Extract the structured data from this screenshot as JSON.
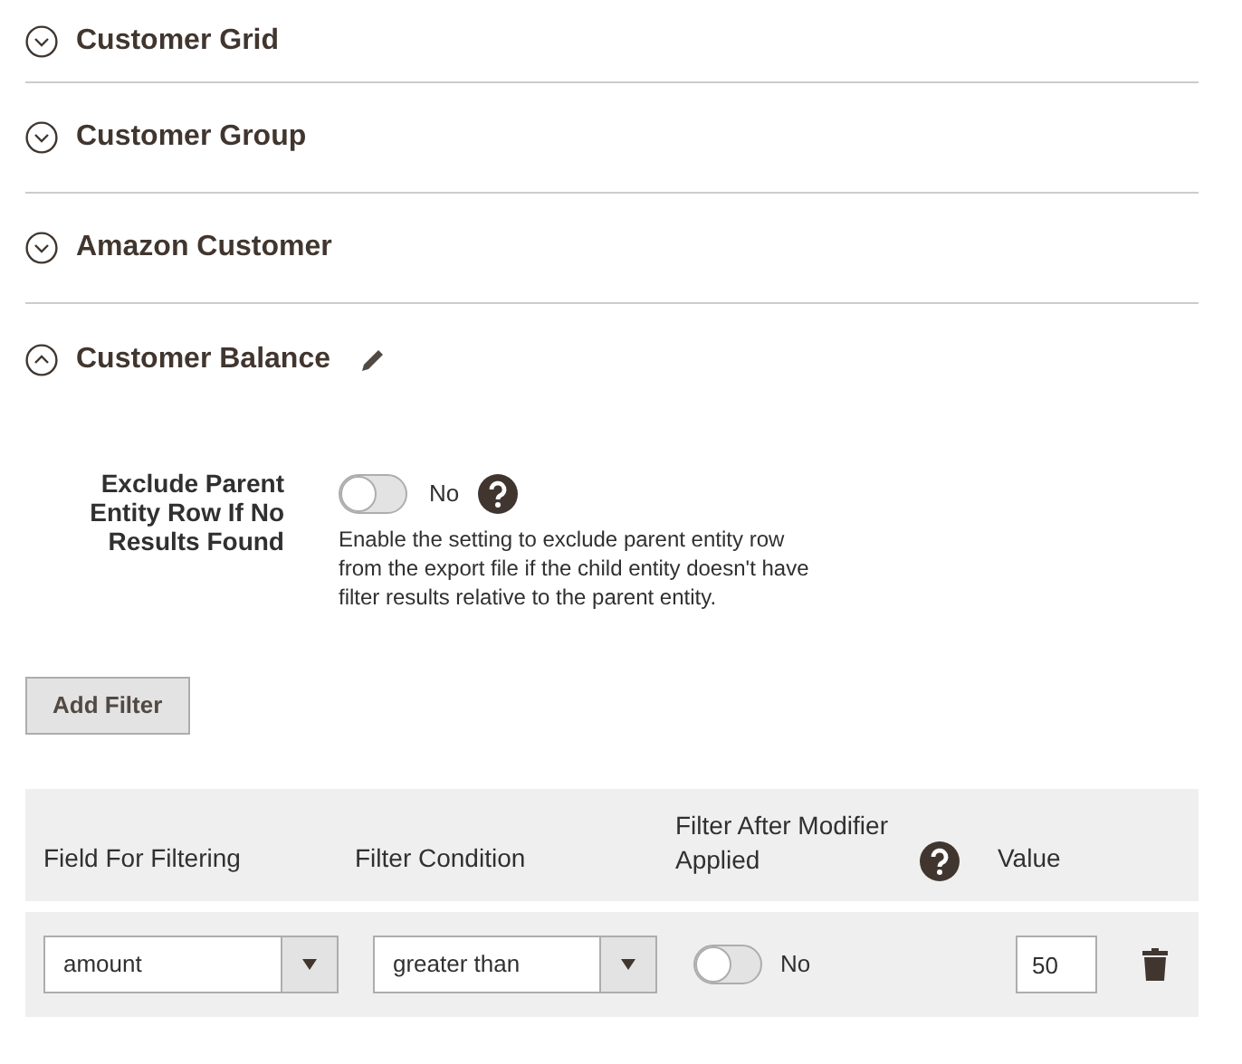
{
  "sections": [
    {
      "title": "Customer Grid",
      "expanded": false
    },
    {
      "title": "Customer Group",
      "expanded": false
    },
    {
      "title": "Amazon Customer",
      "expanded": false
    },
    {
      "title": "Customer Balance",
      "expanded": true,
      "editable": true
    }
  ],
  "setting": {
    "label": "Exclude Parent Entity Row If No Results Found",
    "on": false,
    "state_label": "No",
    "help": "Enable the setting to exclude parent entity row from the export file if the child entity doesn't have filter results relative to the parent entity."
  },
  "add_filter_button": "Add Filter",
  "filter_table": {
    "columns": [
      "Field For Filtering",
      "Filter Condition",
      "Filter After Modifier Applied",
      "Value"
    ],
    "rows": [
      {
        "field": "amount",
        "condition": "greater than",
        "modifier_applied": false,
        "modifier_label": "No",
        "value": "50"
      }
    ]
  }
}
